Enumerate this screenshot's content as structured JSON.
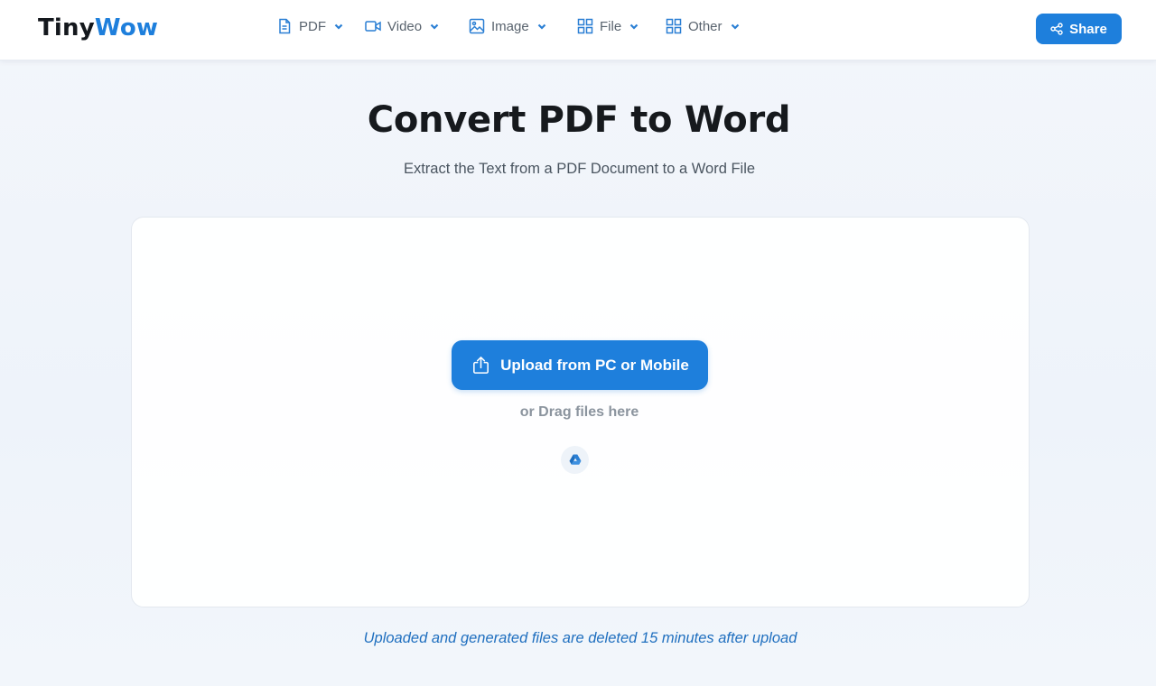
{
  "header": {
    "logo_part1": "Tiny",
    "logo_part2": "Wow",
    "nav": [
      {
        "label": "PDF",
        "icon": "file-document-icon"
      },
      {
        "label": "Video",
        "icon": "video-camera-icon"
      },
      {
        "label": "Image",
        "icon": "image-icon"
      },
      {
        "label": "File",
        "icon": "grid-icon"
      },
      {
        "label": "Other",
        "icon": "grid-icon"
      }
    ],
    "share_label": "Share"
  },
  "main": {
    "title": "Convert PDF to Word",
    "subtitle": "Extract the Text from a PDF Document to a Word File"
  },
  "uploader": {
    "button_label": "Upload from PC or Mobile",
    "drag_text": "or Drag files here",
    "drive_icon": "google-drive-icon"
  },
  "footer_note": "Uploaded and generated files are deleted 15 minutes after upload",
  "colors": {
    "accent": "#1e7fdc",
    "note": "#1f6fbf",
    "nav_icon": "#2a7fd4"
  }
}
